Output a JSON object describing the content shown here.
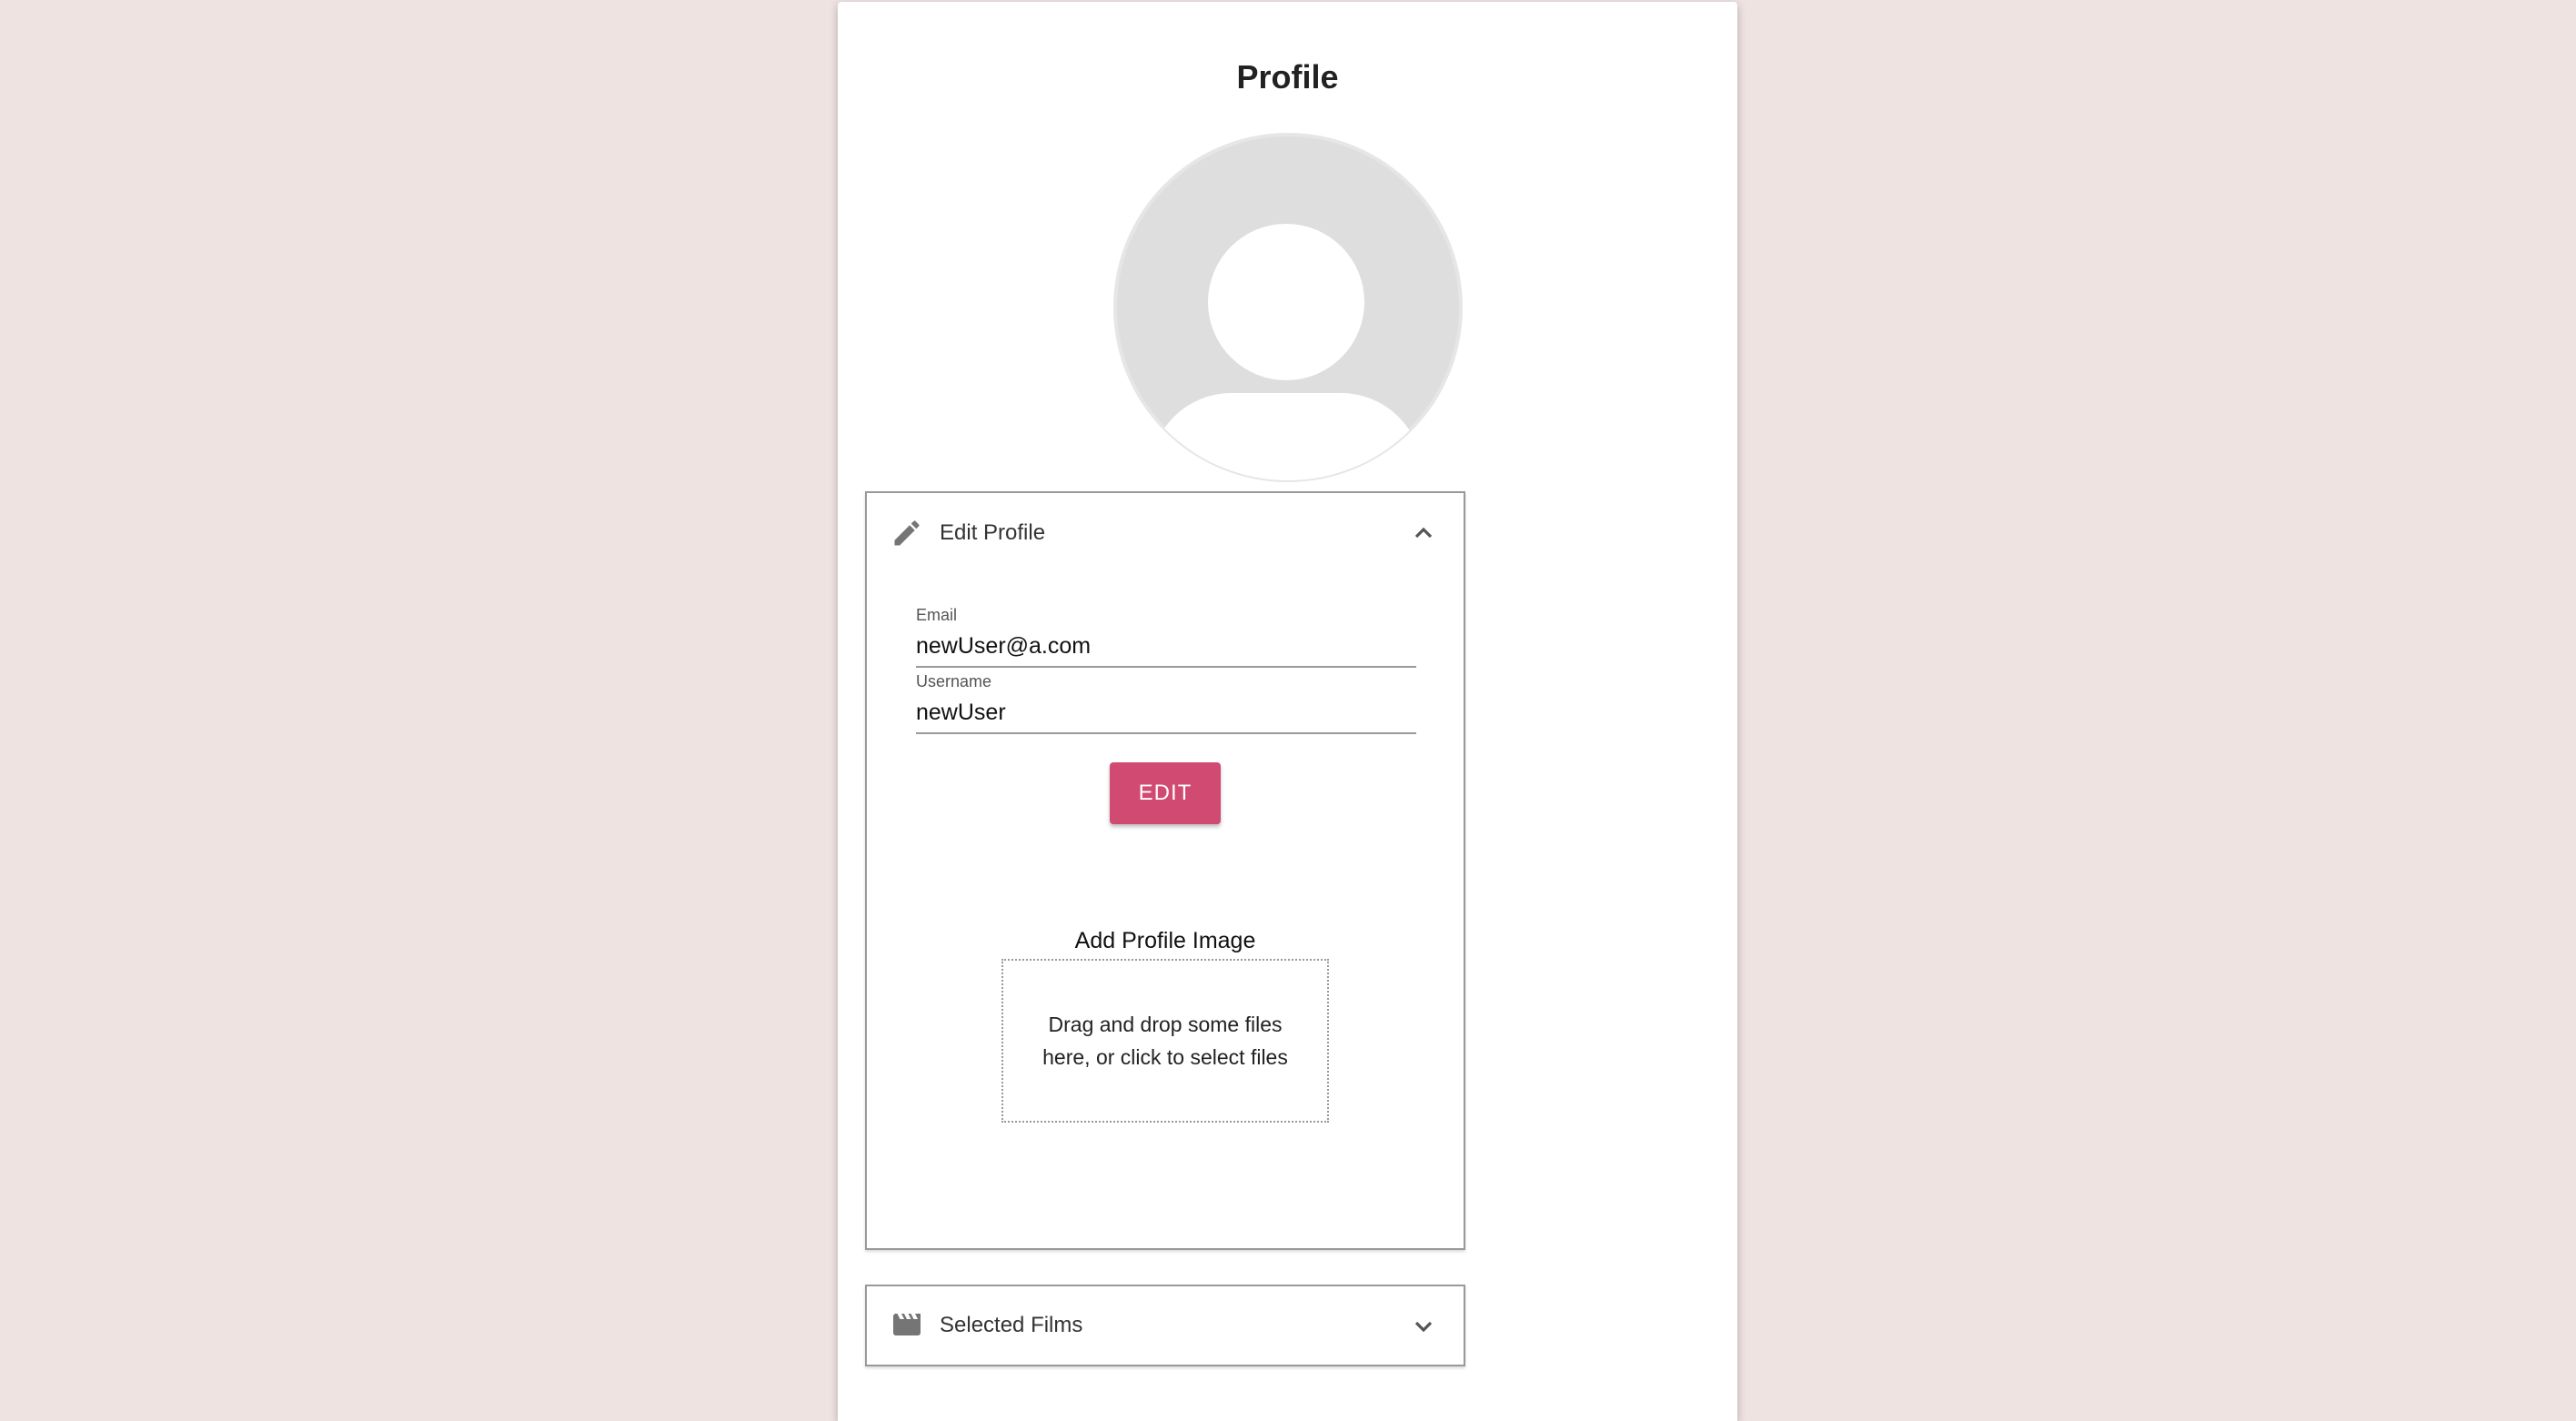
{
  "page": {
    "title": "Profile"
  },
  "colors": {
    "background": "#efe3e2",
    "card": "#ffffff",
    "accent": "#d04a72",
    "avatar_bg": "#dedede"
  },
  "edit_profile": {
    "header_label": "Edit Profile",
    "header_icon": "pencil-icon",
    "expanded": true,
    "email": {
      "label": "Email",
      "value": "newUser@a.com"
    },
    "username": {
      "label": "Username",
      "value": "newUser"
    },
    "edit_button_label": "EDIT",
    "dropzone": {
      "title": "Add Profile Image",
      "text": "Drag and drop some files here, or click to select files"
    }
  },
  "selected_films": {
    "header_label": "Selected Films",
    "header_icon": "movie-clapper-icon",
    "expanded": false
  }
}
